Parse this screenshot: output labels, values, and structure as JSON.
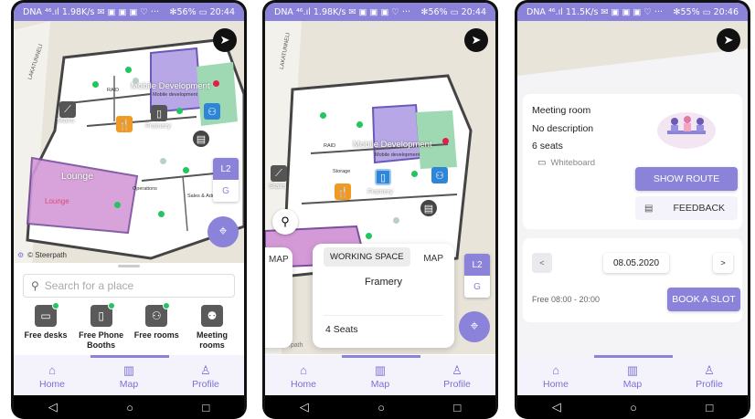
{
  "status": {
    "s1": {
      "left": "DNA ⁴⁶.ıl 1.98K/s ✉ ▣ ▣ ▣ ♡ ···",
      "right": "✻56% ▭ 20:44"
    },
    "s2": {
      "left": "DNA ⁴⁶.ıl 1.98K/s ✉ ▣ ▣ ▣ ♡ ···",
      "right": "✻56% ▭ 20:44"
    },
    "s3": {
      "left": "DNA ⁴⁶.ıl 11.5K/s ✉ ▣ ▣ ▣ ♡ ···",
      "right": "✻55% ▭ 20:46"
    }
  },
  "map": {
    "street": "LAKATUNNELI",
    "mobile_dev": "Mobile Development",
    "mobile_dev_small": "Mobile development",
    "lounge": "Lounge",
    "lounge_small": "Lounge",
    "stairs": "Stairs",
    "framery": "Framery",
    "operations": "Operations",
    "sales": "Sales & Admin",
    "storage": "Storage",
    "raid": "RAID",
    "floor_active": "L2",
    "floor_other": "G",
    "credit": "© Steerpath"
  },
  "search": {
    "placeholder": "Search for a place"
  },
  "categories": [
    {
      "label": "Free desks",
      "icon": "desk-icon"
    },
    {
      "label": "Free Phone Booths",
      "icon": "phone-booth-icon"
    },
    {
      "label": "Free rooms",
      "icon": "room-icon"
    },
    {
      "label": "Meeting rooms",
      "icon": "meeting-room-icon"
    }
  ],
  "tabs": {
    "home": "Home",
    "map": "Map",
    "profile": "Profile"
  },
  "working_card": {
    "map_left": "MAP",
    "badge": "WORKING SPACE",
    "map_right": "MAP",
    "name": "Framery",
    "seats": "4 Seats"
  },
  "room": {
    "title": "Meeting room",
    "description": "No description",
    "seats": "6 seats",
    "amenity": "Whiteboard",
    "show_route": "SHOW ROUTE",
    "feedback": "FEEDBACK"
  },
  "booking": {
    "prev": "<",
    "date": "08.05.2020",
    "next": ">",
    "free_text": "Free 08:00 - 20:00",
    "book": "BOOK A SLOT"
  },
  "colors": {
    "accent": "#8b82d9",
    "free": "#22c55e",
    "busy": "#e11d48",
    "lounge": "#c77dcc"
  }
}
